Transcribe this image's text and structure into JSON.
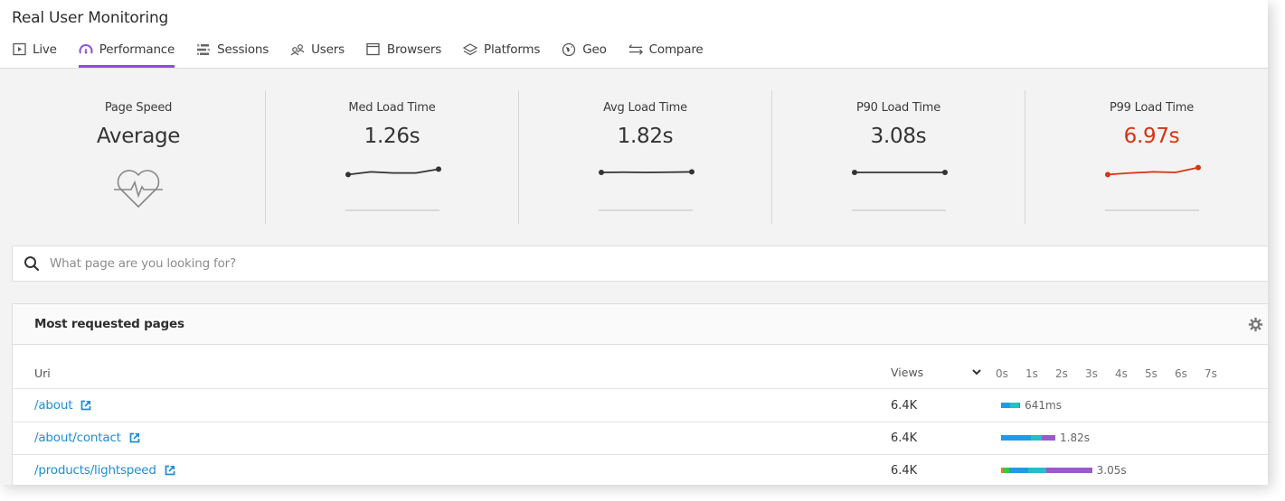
{
  "app": {
    "title": "Real User Monitoring"
  },
  "tabs": [
    {
      "label": "Live",
      "icon": "play-square-icon",
      "active": false
    },
    {
      "label": "Performance",
      "icon": "speedometer-icon",
      "active": true
    },
    {
      "label": "Sessions",
      "icon": "sessions-bars-icon",
      "active": false
    },
    {
      "label": "Users",
      "icon": "users-icon",
      "active": false
    },
    {
      "label": "Browsers",
      "icon": "browser-window-icon",
      "active": false
    },
    {
      "label": "Platforms",
      "icon": "layers-icon",
      "active": false
    },
    {
      "label": "Geo",
      "icon": "globe-icon",
      "active": false
    },
    {
      "label": "Compare",
      "icon": "compare-arrows-icon",
      "active": false
    }
  ],
  "colors": {
    "accent": "#8c4fd1",
    "link": "#1e8fd6",
    "alert": "#d9330f"
  },
  "metrics": {
    "page_speed": {
      "label": "Page Speed",
      "value": "Average",
      "icon": "heartbeat-icon"
    },
    "med": {
      "label": "Med Load Time",
      "value": "1.26s",
      "trend": [
        0.3,
        0.55,
        0.45,
        0.45,
        0.8
      ]
    },
    "avg": {
      "label": "Avg Load Time",
      "value": "1.82s",
      "trend": [
        0.5,
        0.52,
        0.5,
        0.52,
        0.55
      ]
    },
    "p90": {
      "label": "P90 Load Time",
      "value": "3.08s",
      "trend": [
        0.5,
        0.5,
        0.5,
        0.5,
        0.5
      ]
    },
    "p99": {
      "label": "P99 Load Time",
      "value": "6.97s",
      "trend": [
        0.3,
        0.45,
        0.55,
        0.5,
        0.95
      ]
    }
  },
  "search": {
    "placeholder": "What page are you looking for?",
    "value": ""
  },
  "pages_panel": {
    "title": "Most requested pages",
    "columns": {
      "uri": "Uri",
      "views": "Views"
    },
    "timeline_ticks": [
      "0s",
      "1s",
      "2s",
      "3s",
      "4s",
      "5s",
      "6s",
      "7s"
    ],
    "segment_colors": [
      "#f47c20",
      "#2ecc40",
      "#1e9be8",
      "#22bfc6",
      "#9b59d0"
    ],
    "rows": [
      {
        "uri": "/about",
        "views": "6.4K",
        "load_label": "641ms",
        "segments_sec": [
          0,
          0,
          0.29,
          0.32,
          0.03
        ]
      },
      {
        "uri": "/about/contact",
        "views": "6.4K",
        "load_label": "1.82s",
        "segments_sec": [
          0,
          0,
          1.0,
          0.35,
          0.47
        ]
      },
      {
        "uri": "/products/lightspeed",
        "views": "6.4K",
        "load_label": "3.05s",
        "segments_sec": [
          0.06,
          0.2,
          0.66,
          0.6,
          1.53
        ]
      }
    ]
  }
}
